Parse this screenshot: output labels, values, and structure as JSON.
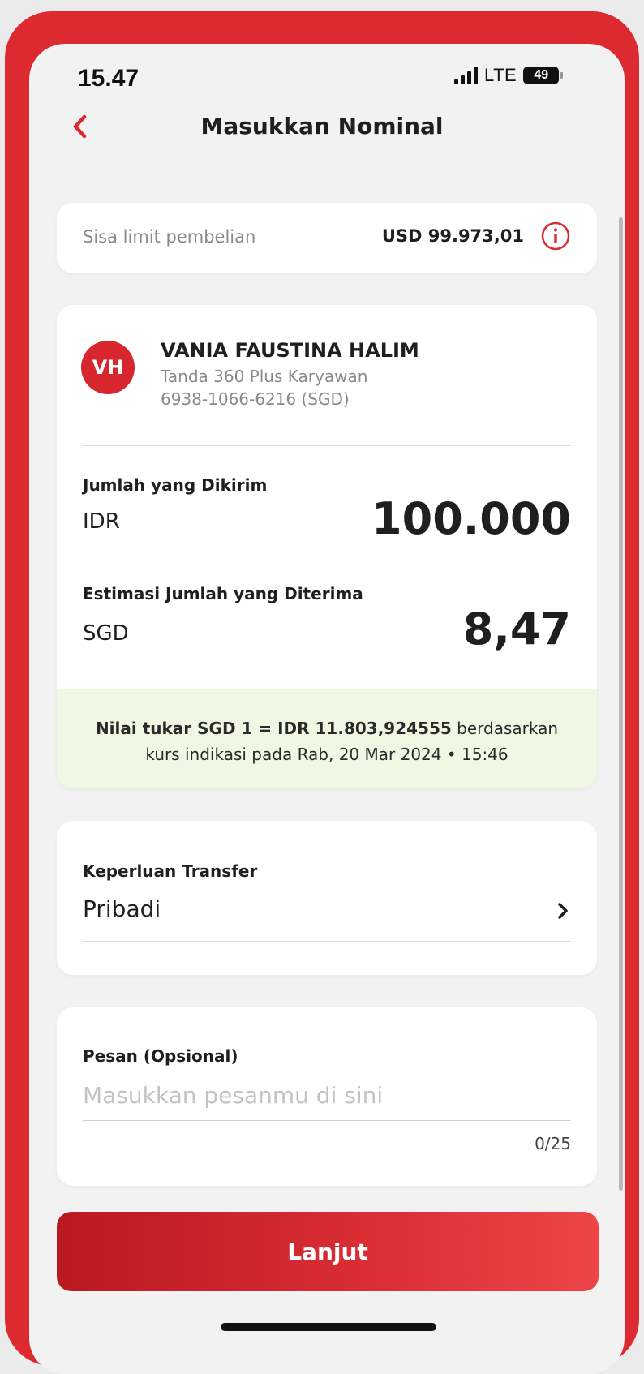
{
  "status_bar": {
    "time": "15.47",
    "network": "LTE",
    "battery": "49"
  },
  "header": {
    "title": "Masukkan Nominal",
    "back_icon": "chevron-left-icon"
  },
  "limit": {
    "label": "Sisa limit pembelian",
    "value": "USD 99.973,01",
    "info_icon": "info-icon"
  },
  "recipient": {
    "initials": "VH",
    "name": "VANIA FAUSTINA HALIM",
    "bank": "Tanda 360 Plus Karyawan",
    "account": "6938-1066-6216 (SGD)"
  },
  "amount_sent": {
    "label": "Jumlah yang Dikirim",
    "currency": "IDR",
    "value": "100.000"
  },
  "amount_received": {
    "label": "Estimasi Jumlah yang Diterima",
    "currency": "SGD",
    "value": "8,47"
  },
  "exchange_rate": {
    "rate_text": "Nilai tukar SGD 1 = IDR 11.803,924555",
    "rate_suffix": " berdasarkan",
    "date_text": "kurs indikasi pada Rab, 20 Mar 2024 • 15:46"
  },
  "purpose": {
    "label": "Keperluan Transfer",
    "value": "Pribadi",
    "chevron_icon": "chevron-right-icon"
  },
  "message": {
    "label": "Pesan (Opsional)",
    "placeholder": "Masukkan pesanmu di sini",
    "value": "",
    "counter": "0/25"
  },
  "actions": {
    "continue_label": "Lanjut"
  },
  "colors": {
    "brand_red": "#dc2a30",
    "rate_bg": "#eef8e3",
    "screen_bg": "#f2f2f2"
  }
}
